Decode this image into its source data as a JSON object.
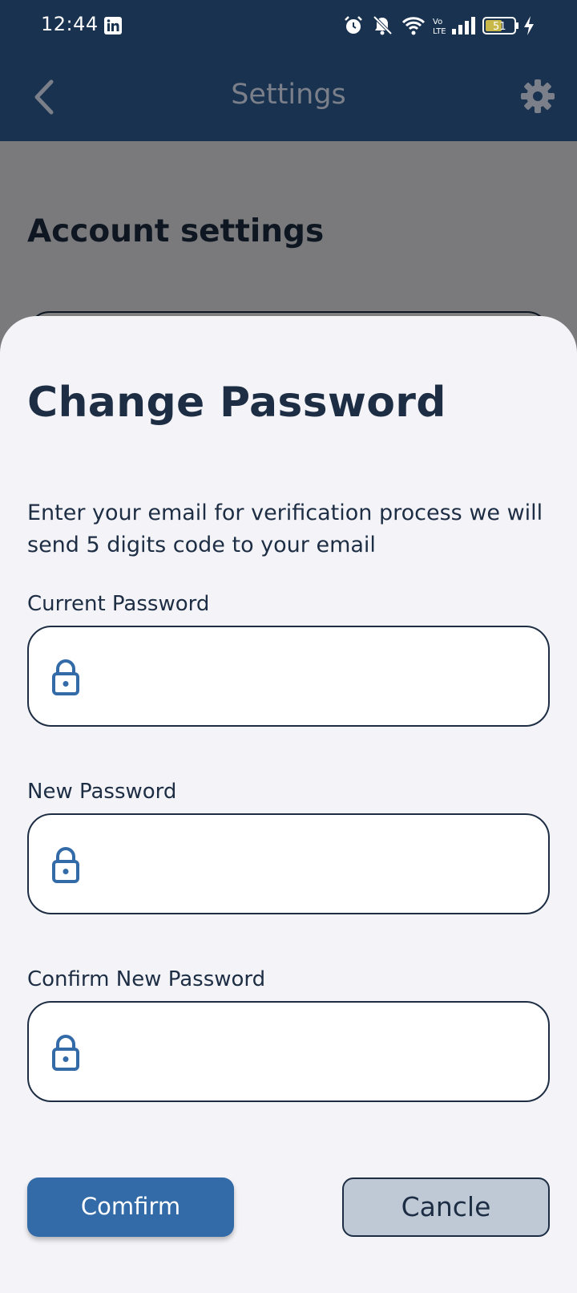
{
  "status_bar": {
    "time": "12:44",
    "battery": "51",
    "icons": [
      "linkedin-icon",
      "alarm-icon",
      "bell-off-icon",
      "wifi-icon",
      "volte-icon",
      "signal-icon",
      "battery-icon",
      "charging-icon"
    ],
    "colors": {
      "background": "#183250",
      "foreground": "#ffffff"
    }
  },
  "header": {
    "title": "Settings",
    "back_icon": "chevron-left-icon",
    "settings_icon": "gear-icon"
  },
  "page": {
    "section_title": "Account settings"
  },
  "sheet": {
    "title": "Change Password",
    "description": "Enter your email for verification process we will send 5 digits code to your email",
    "fields": [
      {
        "label": "Current Password",
        "value": "",
        "icon": "lock-icon"
      },
      {
        "label": "New Password",
        "value": "",
        "icon": "lock-icon"
      },
      {
        "label": "Confirm New Password",
        "value": "",
        "icon": "lock-icon"
      }
    ],
    "confirm_label": "Comfirm",
    "cancel_label": "Cancle"
  },
  "colors": {
    "primary": "#336ba8",
    "dark_navy": "#1d2d44",
    "header_bg": "#183250",
    "sheet_bg": "#f4f4f8",
    "cancel_bg": "#bfc9d6"
  }
}
